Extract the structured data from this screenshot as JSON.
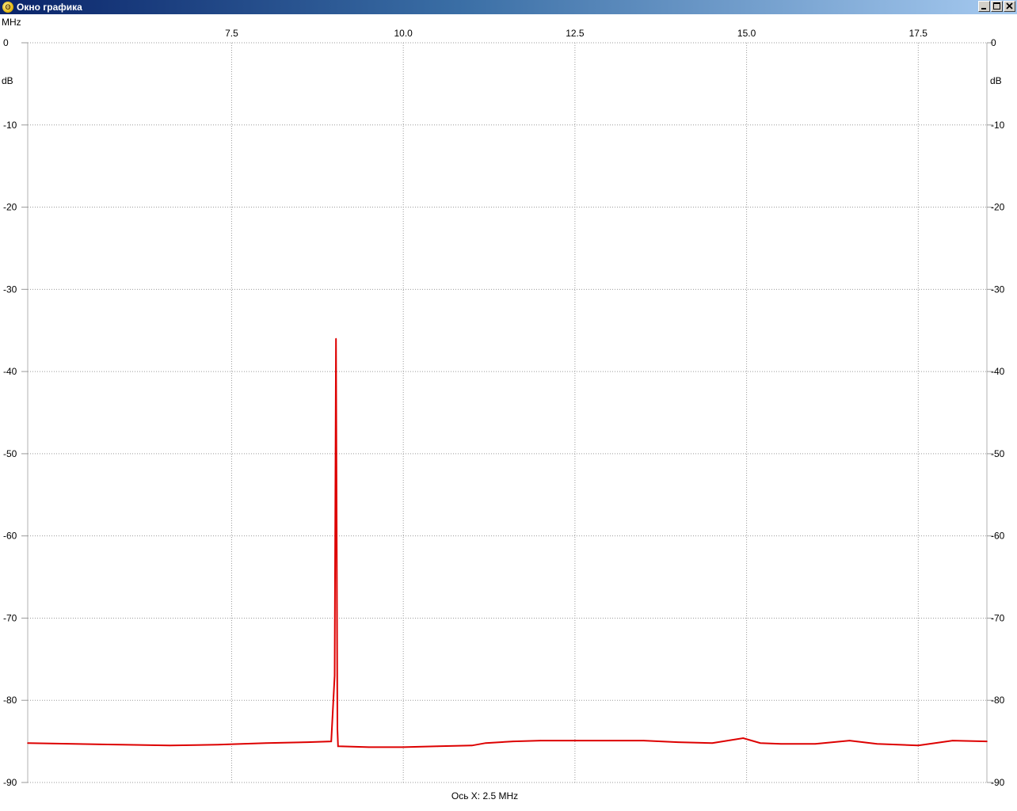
{
  "window": {
    "title": "Окно графика",
    "icon": "app-logo-icon",
    "buttons": [
      "minimize-icon",
      "maximize-icon",
      "close-icon"
    ]
  },
  "chart_data": {
    "type": "line",
    "xlabel": "Ось X: 2.5 MHz",
    "x_unit": "MHz",
    "ylabel": "dB",
    "xlim": [
      4.53,
      18.5
    ],
    "ylim": [
      -90,
      0
    ],
    "x_ticks": [
      7.5,
      10.0,
      12.5,
      15.0,
      17.5
    ],
    "x_tick_labels": [
      "7.5",
      "10.0",
      "12.5",
      "15.0",
      "17.5"
    ],
    "y_ticks": [
      0,
      -10,
      -20,
      -30,
      -40,
      -50,
      -60,
      -70,
      -80,
      -90
    ],
    "y_tick_labels": [
      "0",
      "-10",
      "-20",
      "-30",
      "-40",
      "-50",
      "-60",
      "-70",
      "-80",
      "-90"
    ],
    "grid": true,
    "line_color": "#dd0000",
    "series": [
      {
        "x": [
          4.53,
          5.2,
          5.9,
          6.6,
          7.3,
          8.0,
          8.6,
          8.95,
          9.0,
          9.02,
          9.04,
          9.05,
          9.06,
          9.5,
          10.0,
          10.5,
          11.0,
          11.2,
          11.6,
          12.0,
          12.5,
          13.0,
          13.5,
          14.0,
          14.5,
          14.95,
          15.2,
          15.5,
          16.0,
          16.5,
          16.9,
          17.5,
          18.0,
          18.5
        ],
        "y": [
          -85.2,
          -85.3,
          -85.4,
          -85.5,
          -85.4,
          -85.2,
          -85.1,
          -85.0,
          -77.0,
          -36.0,
          -83.5,
          -85.6,
          -85.6,
          -85.7,
          -85.7,
          -85.6,
          -85.5,
          -85.2,
          -85.0,
          -84.9,
          -84.9,
          -84.9,
          -84.9,
          -85.1,
          -85.2,
          -84.6,
          -85.2,
          -85.3,
          -85.3,
          -84.9,
          -85.3,
          -85.5,
          -84.9,
          -85.0
        ]
      }
    ]
  }
}
